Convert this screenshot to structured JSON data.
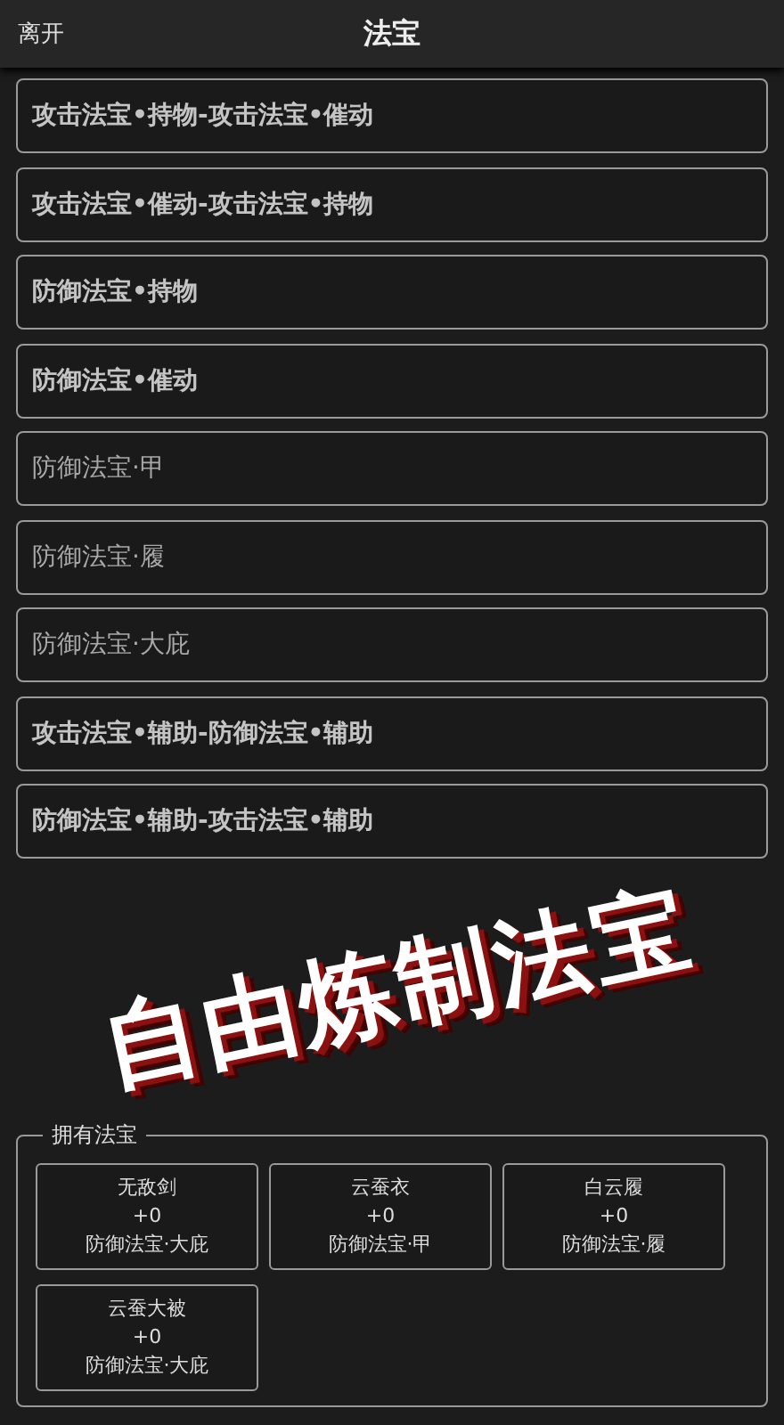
{
  "header": {
    "back": "离开",
    "title": "法宝"
  },
  "recipes": [
    {
      "label": "攻击法宝•持物-攻击法宝•催动",
      "kind": "combo"
    },
    {
      "label": "攻击法宝•催动-攻击法宝•持物",
      "kind": "combo"
    },
    {
      "label": "防御法宝•持物",
      "kind": "combo"
    },
    {
      "label": "防御法宝•催动",
      "kind": "combo"
    },
    {
      "label": "防御法宝·甲",
      "kind": "single"
    },
    {
      "label": "防御法宝·履",
      "kind": "single"
    },
    {
      "label": "防御法宝·大庇",
      "kind": "single"
    },
    {
      "label": "攻击法宝•辅助-防御法宝•辅助",
      "kind": "combo"
    },
    {
      "label": "防御法宝•辅助-攻击法宝•辅助",
      "kind": "combo"
    }
  ],
  "banner": {
    "text": "自由炼制法宝"
  },
  "owned": {
    "legend": "拥有法宝",
    "items": [
      {
        "name": "无敌剑",
        "level": "+0",
        "type": "防御法宝·大庇"
      },
      {
        "name": "云蚕衣",
        "level": "+0",
        "type": "防御法宝·甲"
      },
      {
        "name": "白云履",
        "level": "+0",
        "type": "防御法宝·履"
      },
      {
        "name": "云蚕大被",
        "level": "+0",
        "type": "防御法宝·大庇"
      }
    ]
  }
}
